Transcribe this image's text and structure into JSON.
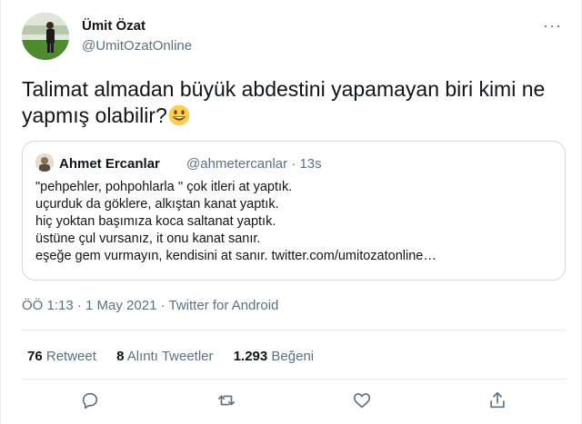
{
  "tweet": {
    "author_name": "Ümit Özat",
    "author_handle": "@UmitOzatOnline",
    "more_label": "···",
    "text": "Talimat almadan büyük abdestini yapamayan biri kimi ne yapmış olabilir?",
    "emoji_icon": "grinning-face-icon",
    "quoted": {
      "author_name": "Ahmet Ercanlar",
      "author_handle": "@ahmetercanlar",
      "time": "13s",
      "lines": [
        "\"pehpehler, pohpohlarla '' çok itleri at yaptık.",
        "uçurduk da göklere, alkıştan kanat yaptık.",
        "hiç yoktan başımıza koca saltanat yaptık.",
        "üstüne çul vursanız, it onu kanat sanır.",
        "eşeğe gem vurmayın, kendisini at sanır. twitter.com/umitozatonline…"
      ]
    },
    "meta": {
      "time": "ÖÖ 1:13",
      "date": "1 May 2021",
      "source": "Twitter for Android",
      "separator": "·"
    },
    "stats": {
      "retweets_count": "76",
      "retweets_label": "Retweet",
      "quotes_count": "8",
      "quotes_label": "Alıntı Tweetler",
      "likes_count": "1.293",
      "likes_label": "Beğeni"
    },
    "actions": [
      "reply-icon",
      "retweet-icon",
      "like-icon",
      "share-icon"
    ]
  },
  "colors": {
    "text": "#0f1419",
    "secondary": "#5b7083",
    "border": "#cfd9de",
    "divider": "#e6ecf0",
    "emoji": "#ffcc4d"
  }
}
